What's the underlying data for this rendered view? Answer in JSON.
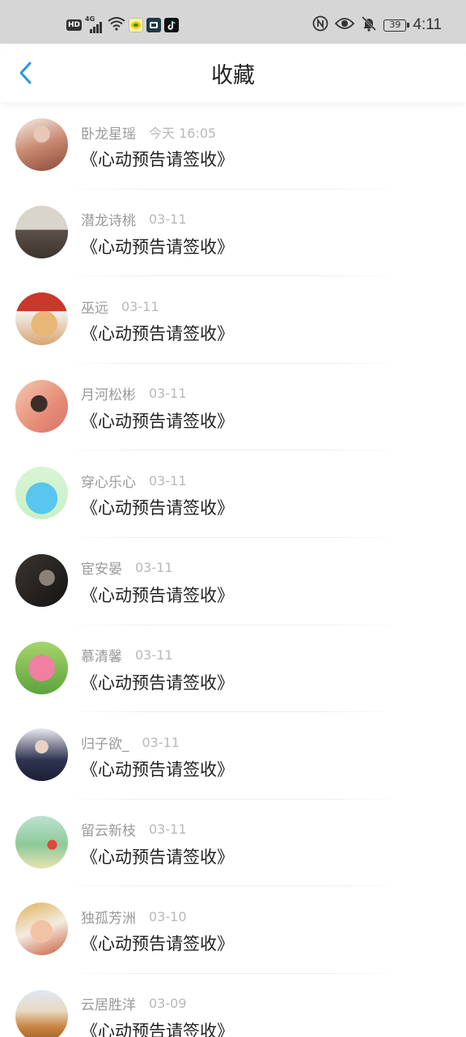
{
  "status_bar": {
    "hd": "HD",
    "network": "4G",
    "battery": "39",
    "time": "4:11"
  },
  "header": {
    "title": "收藏"
  },
  "favorites": [
    {
      "author": "卧龙星瑶",
      "time": "今天 16:05",
      "title": "《心动预告请签收》",
      "avatar_color": "#b76a5a"
    },
    {
      "author": "潜龙诗桃",
      "time": "03-11",
      "title": "《心动预告请签收》",
      "avatar_color": "#7c7068"
    },
    {
      "author": "巫远",
      "time": "03-11",
      "title": "《心动预告请签收》",
      "avatar_color": "#b04a2c"
    },
    {
      "author": "月河松彬",
      "time": "03-11",
      "title": "《心动预告请签收》",
      "avatar_color": "#e69a7e"
    },
    {
      "author": "穿心乐心",
      "time": "03-11",
      "title": "《心动预告请签收》",
      "avatar_color": "#5cc9ea"
    },
    {
      "author": "宦安晏",
      "time": "03-11",
      "title": "《心动预告请签收》",
      "avatar_color": "#2a2724"
    },
    {
      "author": "慕清馨",
      "time": "03-11",
      "title": "《心动预告请签收》",
      "avatar_color": "#e57391"
    },
    {
      "author": "归子欲_",
      "time": "03-11",
      "title": "《心动预告请签收》",
      "avatar_color": "#3c3f5a"
    },
    {
      "author": "留云新枝",
      "time": "03-11",
      "title": "《心动预告请签收》",
      "avatar_color": "#86c9a1"
    },
    {
      "author": "独孤芳洲",
      "time": "03-10",
      "title": "《心动预告请签收》",
      "avatar_color": "#d08a63"
    },
    {
      "author": "云居胜洋",
      "time": "03-09",
      "title": "《心动预告请签收》",
      "avatar_color": "#c58a4e"
    }
  ],
  "colors": {
    "accent": "#2196f3",
    "status_bar_bg": "#d6d6d6",
    "title_text": "#222222",
    "meta_text": "#999999"
  },
  "icons": {
    "back": "chevron-left-icon",
    "wifi": "wifi-icon",
    "eye": "eye-icon",
    "mute": "bell-off-icon",
    "nfc": "nfc-icon",
    "tiktok": "tiktok-icon"
  }
}
